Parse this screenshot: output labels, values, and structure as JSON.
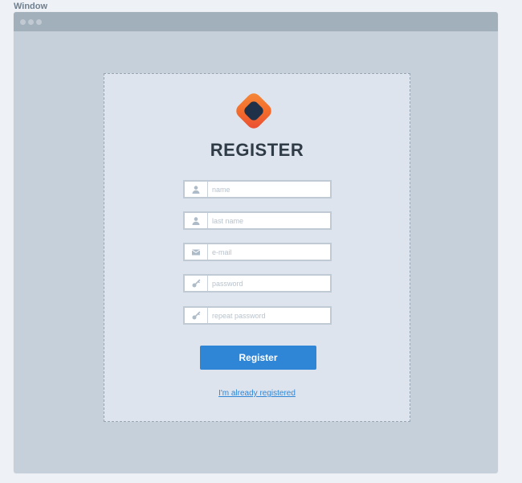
{
  "window": {
    "label": "Window"
  },
  "register": {
    "title": "REGISTER",
    "fields": [
      {
        "name": "name",
        "placeholder": "name",
        "icon": "user-icon"
      },
      {
        "name": "last-name",
        "placeholder": "last name",
        "icon": "user-icon"
      },
      {
        "name": "email",
        "placeholder": "e-mail",
        "icon": "mail-icon"
      },
      {
        "name": "password",
        "placeholder": "password",
        "icon": "key-icon"
      },
      {
        "name": "repeat-password",
        "placeholder": "repeat password",
        "icon": "key-icon"
      }
    ],
    "button_label": "Register",
    "login_link": "I'm already registered"
  },
  "colors": {
    "accent": "#2F86D6",
    "logo_orange": "#F36A2B",
    "logo_red": "#E84A35",
    "logo_dark": "#1F3148",
    "panel_bg": "#DEE4ED",
    "window_bg": "#C5D0DA"
  }
}
